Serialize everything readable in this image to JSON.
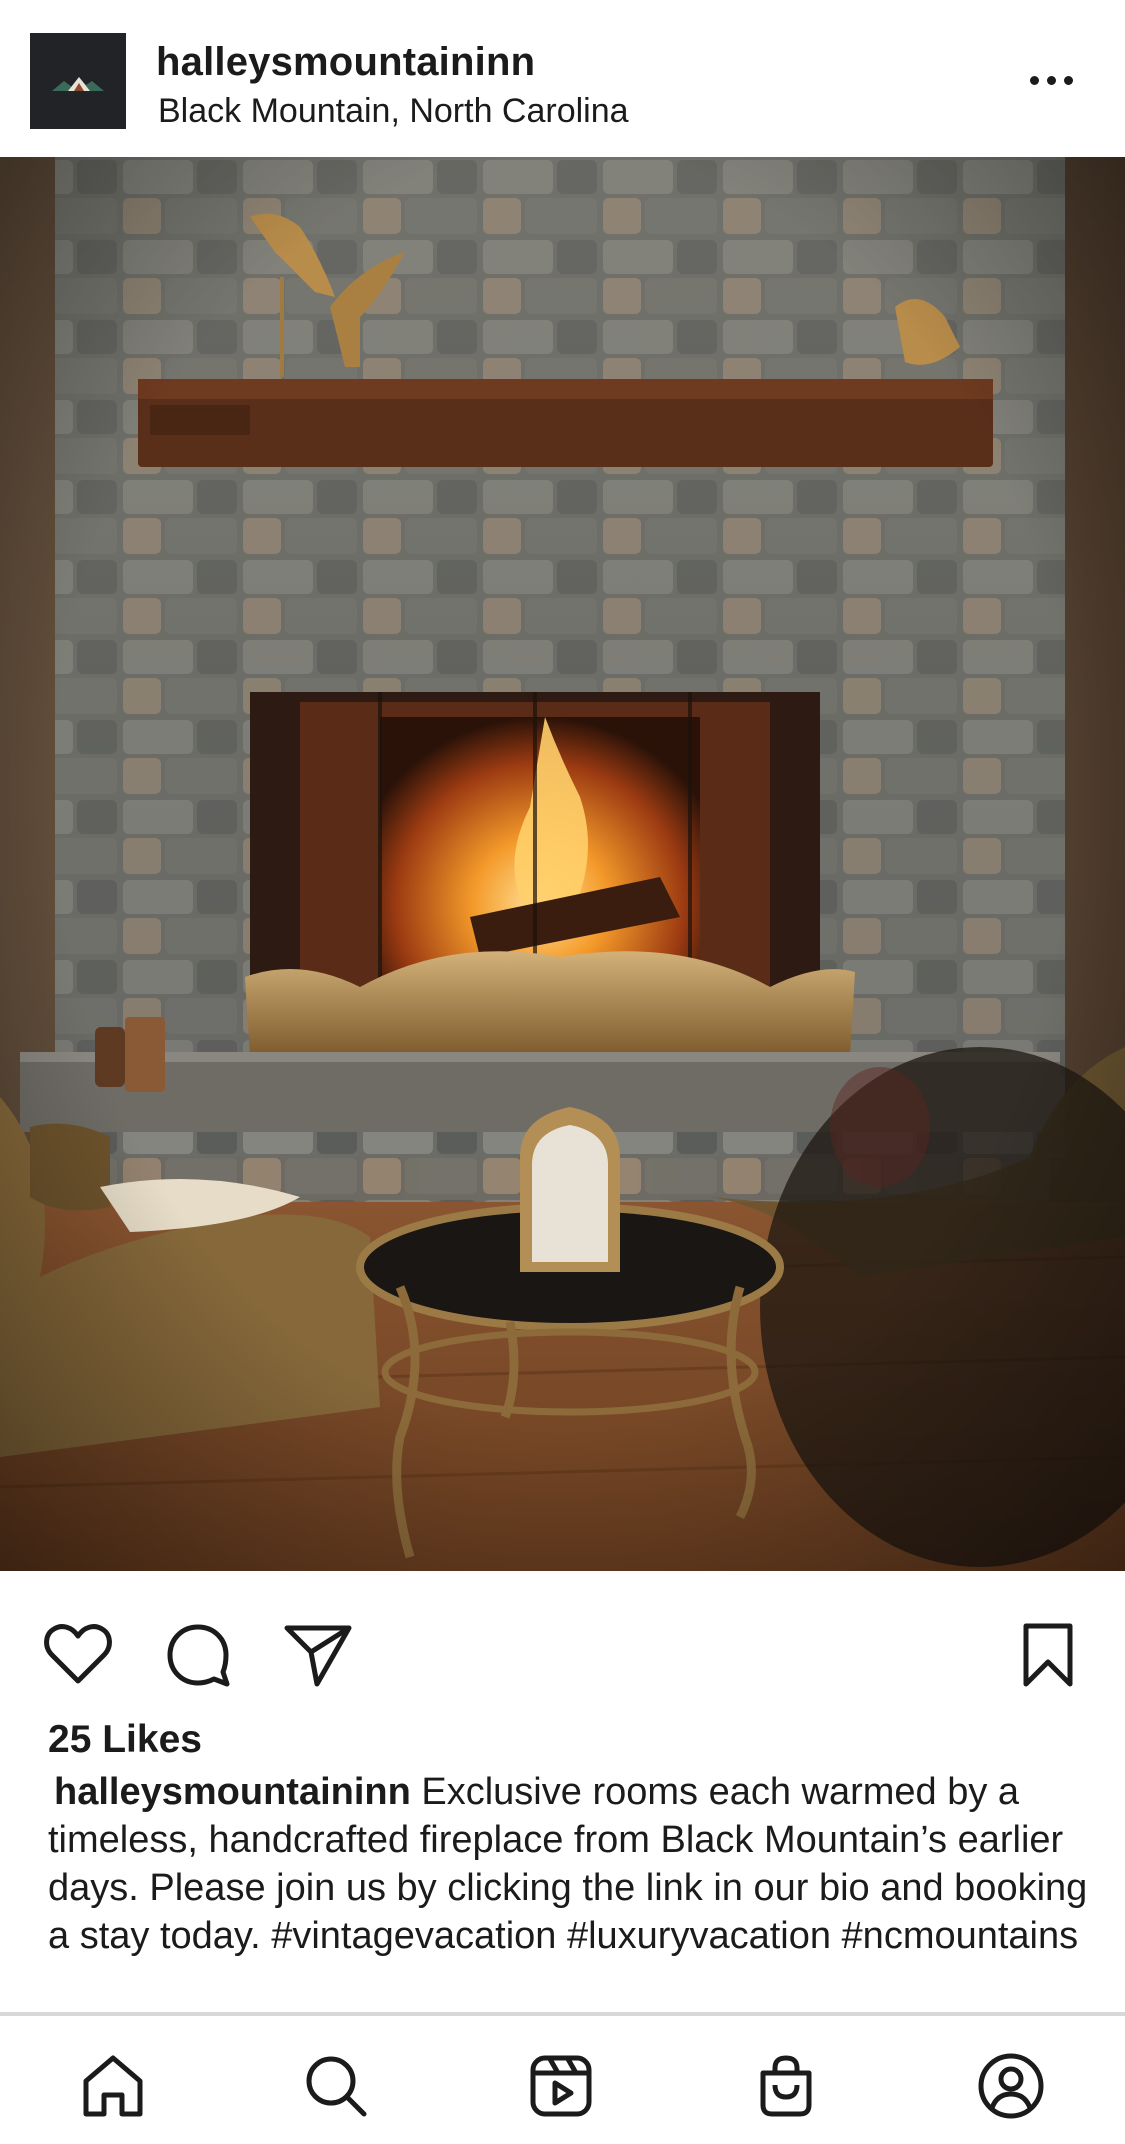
{
  "post": {
    "username": "halleysmountaininn",
    "location": "Black Mountain, North Carolina",
    "likes": "25 Likes",
    "caption_username": "halleysmountaininn",
    "caption_text": " Exclusive rooms each warmed by a timeless, handcrafted fireplace from Black Mountain’s earlier days. Please join us by clicking the link in our bio and booking a stay today. #vintagevacation #luxuryvacation #ncmountains"
  },
  "icons": {
    "header": [
      "avatar-logo",
      "more-options-icon"
    ],
    "actions": [
      "heart-icon",
      "comment-icon",
      "share-icon",
      "bookmark-icon"
    ],
    "bottom_nav": [
      "home-icon",
      "search-icon",
      "reels-icon",
      "shop-icon",
      "profile-icon"
    ]
  },
  "colors": {
    "text": "#1b1b1b",
    "background": "#ffffff",
    "divider": "#d8d8d8"
  }
}
